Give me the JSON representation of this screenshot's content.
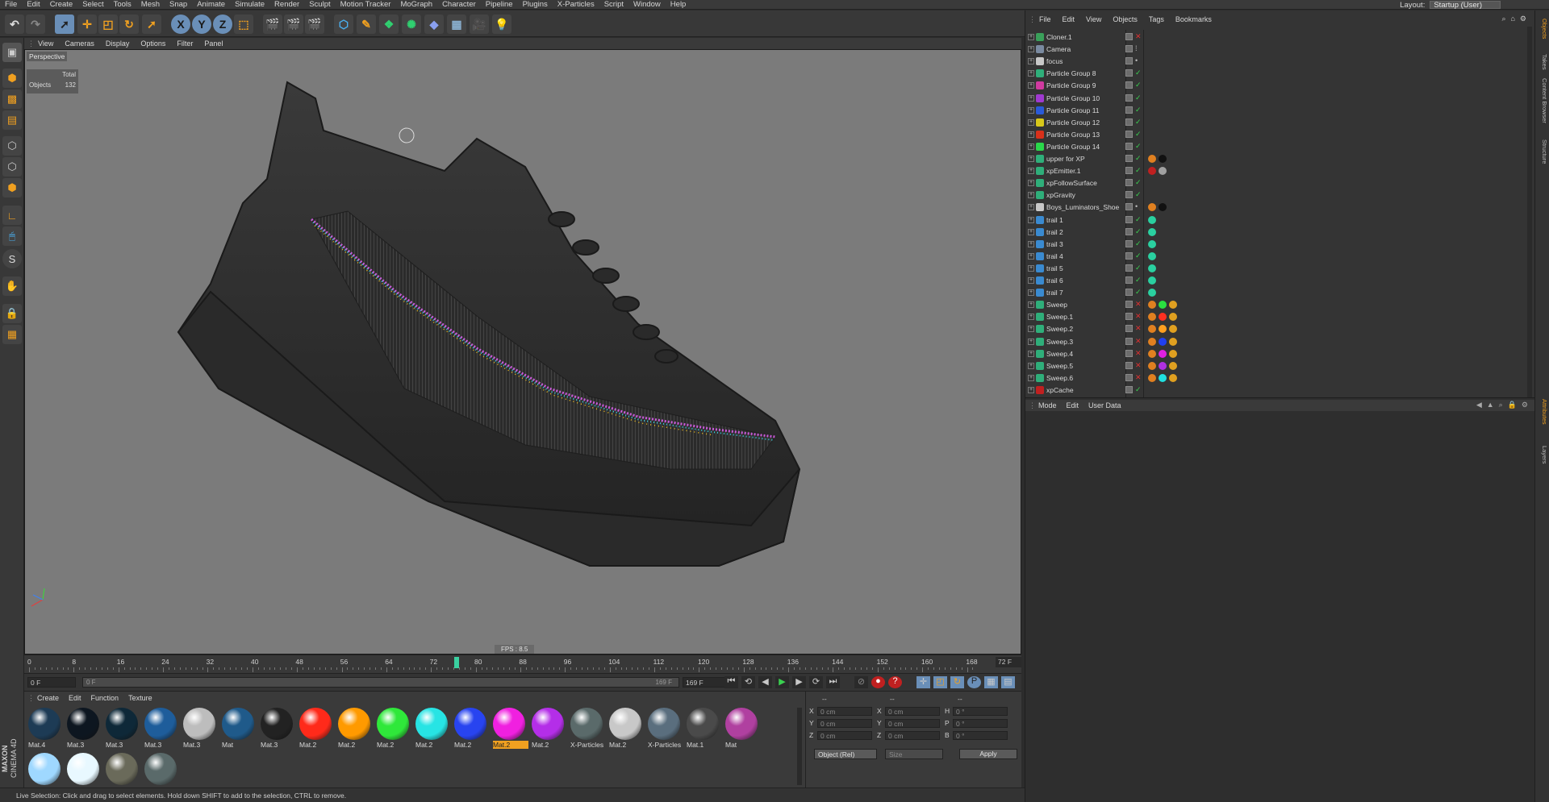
{
  "menubar": {
    "items": [
      "File",
      "Edit",
      "Create",
      "Select",
      "Tools",
      "Mesh",
      "Snap",
      "Animate",
      "Simulate",
      "Render",
      "Sculpt",
      "Motion Tracker",
      "MoGraph",
      "Character",
      "Pipeline",
      "Plugins",
      "X-Particles",
      "Script",
      "Window",
      "Help"
    ],
    "layout_label": "Layout:",
    "layout_value": "Startup (User)"
  },
  "viewport": {
    "menu": [
      "View",
      "Cameras",
      "Display",
      "Options",
      "Filter",
      "Panel"
    ],
    "camera": "Perspective",
    "stats_total": "Total",
    "stats_objects_label": "Objects",
    "stats_objects_value": "132",
    "fps": "FPS : 8.5"
  },
  "timeline": {
    "ticks": [
      "0",
      "8",
      "16",
      "24",
      "32",
      "40",
      "48",
      "56",
      "64",
      "72",
      "80",
      "88",
      "96",
      "104",
      "112",
      "120",
      "128",
      "136",
      "144",
      "152",
      "160",
      "168"
    ],
    "current_frame": "72 F",
    "start_field": "0 F",
    "range_start": "0 F",
    "range_end": "169 F",
    "end_field": "169 F"
  },
  "materials": {
    "menu": [
      "Create",
      "Edit",
      "Function",
      "Texture"
    ],
    "items": [
      {
        "label": "Mat.4",
        "color": "#1d3b55"
      },
      {
        "label": "Mat.3",
        "color": "#0d1620"
      },
      {
        "label": "Mat.3",
        "color": "#0e2838"
      },
      {
        "label": "Mat.3",
        "color": "#1e5d9b"
      },
      {
        "label": "Mat.3",
        "color": "#bdbdbd"
      },
      {
        "label": "Mat",
        "color": "#1f5a8a"
      },
      {
        "label": "Mat.3",
        "color": "#222222"
      },
      {
        "label": "Mat.2",
        "color": "#ff2a1a"
      },
      {
        "label": "Mat.2",
        "color": "#ff9a00"
      },
      {
        "label": "Mat.2",
        "color": "#2fe83a"
      },
      {
        "label": "Mat.2",
        "color": "#27e4e4"
      },
      {
        "label": "Mat.2",
        "color": "#2844f0"
      },
      {
        "label": "Mat.2",
        "color": "#f020e0"
      },
      {
        "label": "Mat.2",
        "color": "#b42ee8"
      },
      {
        "label": "X-Particles",
        "color": "#5a6a6a"
      },
      {
        "label": "Mat.2",
        "color": "#c8c8c8"
      },
      {
        "label": "X-Particles",
        "color": "#5a6e7e"
      },
      {
        "label": "Mat.1",
        "color": "#4a4a4a"
      },
      {
        "label": "Mat",
        "color": "#b040a0"
      },
      {
        "label": "",
        "color": "#9fd8ff"
      },
      {
        "label": "",
        "color": "#e8f8ff"
      },
      {
        "label": "",
        "color": "#6a6a5a"
      },
      {
        "label": "",
        "color": "#5a6a6a"
      }
    ],
    "selected_index": 12
  },
  "coordinates": {
    "header": [
      "--",
      "--",
      "--"
    ],
    "rows": [
      {
        "a": "X",
        "av": "0 cm",
        "b": "X",
        "bv": "0 cm",
        "c": "H",
        "cv": "0 °"
      },
      {
        "a": "Y",
        "av": "0 cm",
        "b": "Y",
        "bv": "0 cm",
        "c": "P",
        "cv": "0 °"
      },
      {
        "a": "Z",
        "av": "0 cm",
        "b": "Z",
        "bv": "0 cm",
        "c": "B",
        "cv": "0 °"
      }
    ],
    "mode": "Object (Rel)",
    "size": "Size",
    "apply": "Apply"
  },
  "objects": {
    "menu": [
      "File",
      "Edit",
      "View",
      "Objects",
      "Tags",
      "Bookmarks"
    ],
    "rows": [
      {
        "name": "Cloner.1",
        "icon": "#3aa05a",
        "check": "x"
      },
      {
        "name": "Camera",
        "icon": "#7a8aa0",
        "check": "dots"
      },
      {
        "name": "focus",
        "icon": "#c8c8c8",
        "check": "dot"
      },
      {
        "name": "Particle Group 8",
        "icon": "#2fae7a",
        "check": "v"
      },
      {
        "name": "Particle Group 9",
        "icon": "#d03aa0",
        "check": "v"
      },
      {
        "name": "Particle Group 10",
        "icon": "#a03ad0",
        "check": "v"
      },
      {
        "name": "Particle Group 11",
        "icon": "#2a5ad8",
        "check": "v"
      },
      {
        "name": "Particle Group 12",
        "icon": "#d8c81a",
        "check": "v"
      },
      {
        "name": "Particle Group 13",
        "icon": "#d8301a",
        "check": "v"
      },
      {
        "name": "Particle Group 14",
        "icon": "#2ad84a",
        "check": "v"
      },
      {
        "name": "upper for XP",
        "icon": "#2fae7a",
        "check": "v",
        "tags": [
          "#e08020",
          "#111111"
        ]
      },
      {
        "name": "xpEmitter.1",
        "icon": "#2fae7a",
        "check": "v",
        "tags": [
          "#c02020",
          "#a0a0a0"
        ]
      },
      {
        "name": "xpFollowSurface",
        "icon": "#2fae7a",
        "check": "v"
      },
      {
        "name": "xpGravity",
        "icon": "#2fae7a",
        "check": "v"
      },
      {
        "name": "Boys_Luminators_Shoe",
        "icon": "#c8c8c8",
        "check": "dot",
        "tags": [
          "#e08020",
          "#111111"
        ]
      },
      {
        "name": "trail 1",
        "icon": "#3a8ad0",
        "check": "v",
        "tags": [
          "#2ad0a0"
        ]
      },
      {
        "name": "trail 2",
        "icon": "#3a8ad0",
        "check": "v",
        "tags": [
          "#2ad0a0"
        ]
      },
      {
        "name": "trail 3",
        "icon": "#3a8ad0",
        "check": "v",
        "tags": [
          "#2ad0a0"
        ]
      },
      {
        "name": "trail 4",
        "icon": "#3a8ad0",
        "check": "v",
        "tags": [
          "#2ad0a0"
        ]
      },
      {
        "name": "trail 5",
        "icon": "#3a8ad0",
        "check": "v",
        "tags": [
          "#2ad0a0"
        ]
      },
      {
        "name": "trail 6",
        "icon": "#3a8ad0",
        "check": "v",
        "tags": [
          "#2ad0a0"
        ]
      },
      {
        "name": "trail 7",
        "icon": "#3a8ad0",
        "check": "v",
        "tags": [
          "#2ad0a0"
        ]
      },
      {
        "name": "Sweep",
        "icon": "#2fae7a",
        "check": "x",
        "tags": [
          "#e08020",
          "#2ae040",
          "#e0a020"
        ]
      },
      {
        "name": "Sweep.1",
        "icon": "#2fae7a",
        "check": "x",
        "tags": [
          "#e08020",
          "#ff3020",
          "#e0a020"
        ]
      },
      {
        "name": "Sweep.2",
        "icon": "#2fae7a",
        "check": "x",
        "tags": [
          "#e08020",
          "#ffa020",
          "#e0a020"
        ]
      },
      {
        "name": "Sweep.3",
        "icon": "#2fae7a",
        "check": "x",
        "tags": [
          "#e08020",
          "#2040f0",
          "#e0a020"
        ]
      },
      {
        "name": "Sweep.4",
        "icon": "#2fae7a",
        "check": "x",
        "tags": [
          "#e08020",
          "#e020e0",
          "#e0a020"
        ]
      },
      {
        "name": "Sweep.5",
        "icon": "#2fae7a",
        "check": "x",
        "tags": [
          "#e08020",
          "#b030e0",
          "#e0a020"
        ]
      },
      {
        "name": "Sweep.6",
        "icon": "#2fae7a",
        "check": "x",
        "tags": [
          "#e08020",
          "#20e0e0",
          "#e0a020"
        ]
      },
      {
        "name": "xpCache",
        "icon": "#c02020",
        "check": "v"
      }
    ]
  },
  "attributes": {
    "menu": [
      "Mode",
      "Edit",
      "User Data"
    ]
  },
  "right_tabs": [
    "Objects",
    "Takes",
    "Content Browser",
    "Structure",
    "Attributes",
    "Layers"
  ],
  "brand": {
    "line1": "MAXON",
    "line2": "CINEMA 4D"
  },
  "status": "Live Selection: Click and drag to select elements. Hold down SHIFT to add to the selection, CTRL to remove."
}
